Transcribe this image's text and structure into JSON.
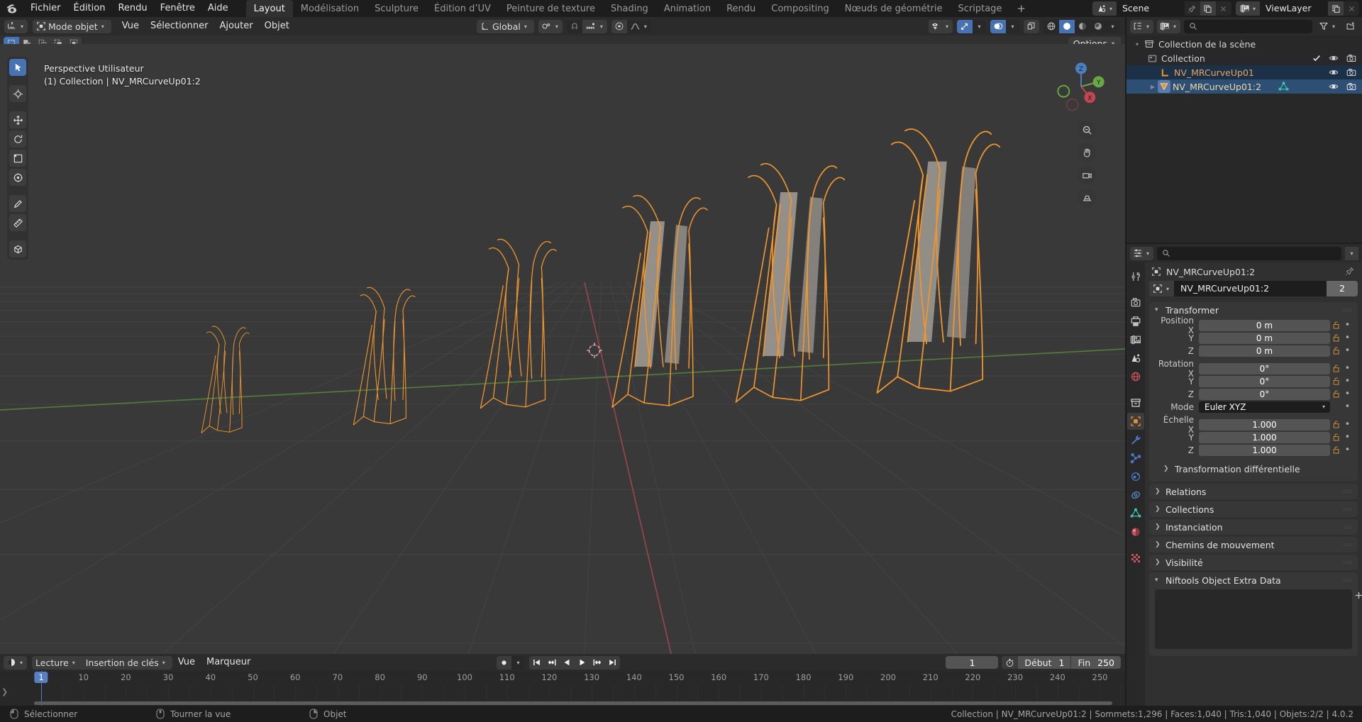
{
  "app": {
    "version": "4.0.2"
  },
  "topbar": {
    "logo_icon": "blender-logo-icon",
    "menus": [
      "Fichier",
      "Édition",
      "Rendu",
      "Fenêtre",
      "Aide"
    ],
    "workspaces": [
      {
        "label": "Layout",
        "active": true
      },
      {
        "label": "Modélisation",
        "active": false
      },
      {
        "label": "Sculpture",
        "active": false
      },
      {
        "label": "Édition d’UV",
        "active": false
      },
      {
        "label": "Peinture de texture",
        "active": false
      },
      {
        "label": "Shading",
        "active": false
      },
      {
        "label": "Animation",
        "active": false
      },
      {
        "label": "Rendu",
        "active": false
      },
      {
        "label": "Compositing",
        "active": false
      },
      {
        "label": "Nœuds de géométrie",
        "active": false
      },
      {
        "label": "Scriptage",
        "active": false
      }
    ],
    "add_workspace_label": "+",
    "scene": {
      "icon": "scene-icon",
      "name": "Scene",
      "pin_icon": "pin-icon",
      "dup_icon": "duplicate-icon",
      "close_icon": "close-icon"
    },
    "viewlayer": {
      "icon": "viewlayer-icon",
      "name": "ViewLayer",
      "dup_icon": "duplicate-icon",
      "close_icon": "close-icon"
    }
  },
  "viewport_header": {
    "editor_type_icon": "editor-type-3dview-icon",
    "mode": {
      "icon": "object-mode-icon",
      "label": "Mode objet"
    },
    "menus": [
      "Vue",
      "Sélectionner",
      "Ajouter",
      "Objet"
    ],
    "transform_orientation": {
      "icon": "orientation-icon",
      "label": "Global"
    },
    "snap_icon": "magnet-icon",
    "snap_target_icon": "snap-increment-icon",
    "proportional_icon": "proportional-edit-icon",
    "falloff_icon": "smooth-falloff-icon",
    "gizmo_icon": "gizmo-icon",
    "overlays_icon": "overlays-icon",
    "xray_icon": "xray-icon",
    "shading": [
      "wireframe",
      "solid",
      "material-preview",
      "rendered"
    ],
    "shading_active": "solid",
    "view_object_types_icon": "visibility-icon"
  },
  "viewport_subheader": {
    "select_modes": [
      "select-new-icon",
      "select-extend-icon",
      "select-subtract-icon",
      "select-invert-icon",
      "select-intersect-icon"
    ],
    "active_select_mode": 0,
    "options_label": "Options"
  },
  "viewport": {
    "overlay_line1": "Perspective Utilisateur",
    "overlay_line2": "(1) Collection | NV_MRCurveUp01:2",
    "gizmo_axes": [
      "Z",
      "Y",
      "X"
    ],
    "tools": [
      {
        "name": "tweak-tool",
        "icon": "cursor-arrow-icon",
        "active": true
      },
      {
        "name": "cursor-tool",
        "icon": "crosshair-icon",
        "active": false
      },
      {
        "name": "move-tool",
        "icon": "move-arrows-icon",
        "active": false
      },
      {
        "name": "rotate-tool",
        "icon": "rotate-icon",
        "active": false
      },
      {
        "name": "scale-tool",
        "icon": "scale-icon",
        "active": false
      },
      {
        "name": "transform-tool",
        "icon": "transform-icon",
        "active": false
      },
      {
        "name": "annotate-tool",
        "icon": "pencil-icon",
        "active": false
      },
      {
        "name": "measure-tool",
        "icon": "ruler-icon",
        "active": false
      },
      {
        "name": "add-cube-tool",
        "icon": "add-cube-icon",
        "active": false
      }
    ],
    "nav_buttons": [
      "zoom-icon",
      "pan-hand-icon",
      "camera-view-icon",
      "ortho-persp-icon"
    ],
    "grid_color": "#4a4a4a",
    "bg_color": "#393939",
    "axis_x_color": "#a1464f",
    "axis_y_color": "#5b8a3c",
    "object_color": "#e8922c",
    "objects_count": 6
  },
  "timeline": {
    "editor_icon": "timeline-editor-icon",
    "menus": [
      "Lecture",
      "Insertion de clés",
      "Vue",
      "Marqueur"
    ],
    "menus_with_caret": [
      true,
      true,
      false,
      false
    ],
    "record_icon": "record-icon",
    "playback_icons": [
      "jump-start-icon",
      "prev-keyframe-icon",
      "play-reverse-icon",
      "play-icon",
      "next-keyframe-icon",
      "jump-end-icon"
    ],
    "current_frame": "1",
    "range_icon": "stopwatch-icon",
    "start_label": "Début",
    "start_value": "1",
    "end_label": "Fin",
    "end_value": "250",
    "ticks": [
      "1",
      "10",
      "20",
      "30",
      "40",
      "50",
      "60",
      "70",
      "80",
      "90",
      "100",
      "110",
      "120",
      "130",
      "140",
      "150",
      "160",
      "170",
      "180",
      "190",
      "200",
      "210",
      "220",
      "230",
      "240",
      "250"
    ],
    "playhead_frame": "1"
  },
  "outliner": {
    "display_mode_icon": "outliner-display-icon",
    "filter_id_icon": "viewlayer-icon",
    "search_placeholder": "",
    "search_value": "",
    "filter_icon": "funnel-icon",
    "new_collection_icon": "new-collection-icon",
    "rows": [
      {
        "indent": 0,
        "disclosure": "open",
        "icon": "scene-collection-icon",
        "name": "Collection de la scène",
        "name_color": "#d5d5d5",
        "selected": "",
        "checkbox": false,
        "eye": false,
        "camera": false
      },
      {
        "indent": 1,
        "disclosure": "",
        "icon": "collection-icon",
        "name": "Collection",
        "name_color": "#d5d5d5",
        "selected": "",
        "checkbox": true,
        "eye": true,
        "camera": true
      },
      {
        "indent": 2,
        "disclosure": "",
        "icon": "armature-empty-icon",
        "name": "NV_MRCurveUp01",
        "name_color": "#e8a35c",
        "selected": "sel-a",
        "checkbox": false,
        "eye": true,
        "camera": true
      },
      {
        "indent": 2,
        "disclosure": "closed",
        "icon": "mesh-data-icon",
        "name": "NV_MRCurveUp01:2",
        "name_color": "#f0d8a8",
        "selected": "sel-b",
        "checkbox": false,
        "eye": true,
        "camera": true,
        "extra_icon": "mesh-triangle-icon"
      }
    ]
  },
  "properties": {
    "editor_icon": "properties-editor-icon",
    "search_placeholder": "",
    "search_value": "",
    "options_caret_icon": "chevron-down-icon",
    "tabs": [
      {
        "name": "tool-tab",
        "icon": "tool-screwdriver-wrench-icon",
        "active": false
      },
      {
        "name": "render-tab",
        "icon": "camera-back-icon",
        "active": false
      },
      {
        "name": "output-tab",
        "icon": "printer-icon",
        "active": false
      },
      {
        "name": "view-layer-tab",
        "icon": "images-stack-icon",
        "active": false
      },
      {
        "name": "scene-tab",
        "icon": "cone-sphere-icon",
        "active": false
      },
      {
        "name": "world-tab",
        "icon": "globe-icon",
        "active": false
      },
      {
        "name": "collection-tab",
        "icon": "collection-box-icon",
        "active": false
      },
      {
        "name": "object-tab",
        "icon": "object-square-icon",
        "active": true
      },
      {
        "name": "modifier-tab",
        "icon": "wrench-icon",
        "active": false
      },
      {
        "name": "particles-tab",
        "icon": "particles-icon",
        "active": false
      },
      {
        "name": "physics-tab",
        "icon": "physics-orbit-icon",
        "active": false
      },
      {
        "name": "constraints-tab",
        "icon": "constraint-icon",
        "active": false
      },
      {
        "name": "data-tab",
        "icon": "mesh-data-green-icon",
        "active": false
      },
      {
        "name": "material-tab",
        "icon": "material-sphere-icon",
        "active": false
      },
      {
        "name": "texture-tab",
        "icon": "checker-texture-icon",
        "active": false
      }
    ],
    "breadcrumb_icon": "object-square-icon",
    "breadcrumb_label": "NV_MRCurveUp01:2",
    "pin_icon": "pin-icon",
    "id_block": {
      "icon": "object-square-icon",
      "name": "NV_MRCurveUp01:2",
      "users": "2"
    },
    "transform_panel": {
      "title": "Transformer",
      "rows": [
        {
          "label": "Position X",
          "value": "0 m"
        },
        {
          "label": "Y",
          "value": "0 m"
        },
        {
          "label": "Z",
          "value": "0 m"
        },
        {
          "label": "Rotation X",
          "value": "0°"
        },
        {
          "label": "Y",
          "value": "0°"
        },
        {
          "label": "Z",
          "value": "0°"
        },
        {
          "label": "Mode",
          "value": "Euler XYZ",
          "dropdown": true
        },
        {
          "label": "Échelle X",
          "value": "1.000"
        },
        {
          "label": "Y",
          "value": "1.000"
        },
        {
          "label": "Z",
          "value": "1.000"
        }
      ],
      "sub_panel": "Transformation différentielle"
    },
    "collapsed_panels": [
      "Relations",
      "Collections",
      "Instanciation",
      "Chemins de mouvement",
      "Visibilité"
    ],
    "open_panel": "Niftools Object Extra Data"
  },
  "statusbar": {
    "mouse_hints": [
      {
        "icon": "mouse-left-icon",
        "label": "Sélectionner"
      },
      {
        "icon": "mouse-middle-icon",
        "label": "Tourner la vue"
      },
      {
        "icon": "mouse-right-icon",
        "label": "Objet"
      }
    ],
    "stats": "Collection | NV_MRCurveUp01:2 | Sommets:1,296 | Faces:1,040 | Tris:1,040 | Objets:2/2 | 4.0.2"
  }
}
